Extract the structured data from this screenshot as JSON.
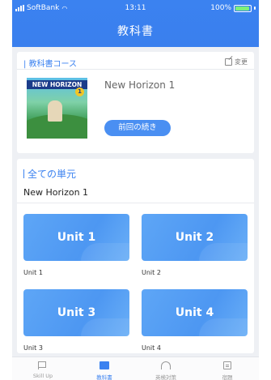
{
  "status_bar": {
    "carrier": "SoftBank",
    "time": "13:11",
    "battery": "100%"
  },
  "header": {
    "title": "教科書"
  },
  "course_section": {
    "heading": "| 教科書コース",
    "change_label": "変更",
    "cover_title": "NEW HORIZON",
    "cover_badge": "1",
    "book_name": "New Horizon 1",
    "resume_button": "前回の続き"
  },
  "units_section": {
    "heading": "全ての単元",
    "book_name": "New Horizon 1",
    "units": [
      {
        "tile": "Unit 1",
        "label": "Unit 1"
      },
      {
        "tile": "Unit 2",
        "label": "Unit 2"
      },
      {
        "tile": "Unit 3",
        "label": "Unit 3"
      },
      {
        "tile": "Unit 4",
        "label": "Unit 4"
      }
    ]
  },
  "tabbar": {
    "tabs": [
      {
        "label": "Skill Up",
        "icon": "flag-icon"
      },
      {
        "label": "教科書",
        "icon": "book-icon",
        "active": true
      },
      {
        "label": "英検対策",
        "icon": "headphones-icon"
      },
      {
        "label": "宿題",
        "icon": "document-icon"
      }
    ]
  },
  "colors": {
    "accent": "#3b82f0",
    "tile": "#4d97f2",
    "background": "#eef0f4"
  }
}
